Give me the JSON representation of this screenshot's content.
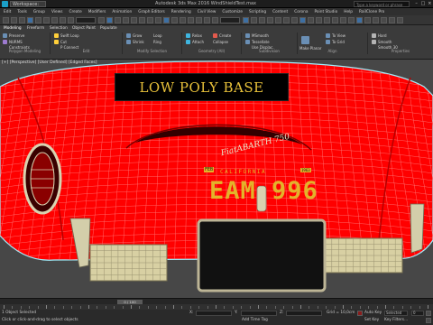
{
  "window": {
    "title": "Autodesk 3ds Max 2016    WindShieldTest.max",
    "workspace": "Workspace: Default",
    "search_placeholder": "Type a keyword or phrase"
  },
  "menu": [
    "Edit",
    "Tools",
    "Group",
    "Views",
    "Create",
    "Modifiers",
    "Animation",
    "Graph Editors",
    "Rendering",
    "Civil View",
    "Customize",
    "Scripting",
    "Content",
    "Corona",
    "Point Studio",
    "Help",
    "RailClone Pro"
  ],
  "ribbon": {
    "tabs": [
      "Modeling",
      "Freeform",
      "Selection",
      "Object Paint",
      "Populate"
    ],
    "groups": [
      {
        "label": "Polygon Modeling",
        "items": [
          "Preserve",
          "NURMS",
          "Constraints"
        ]
      },
      {
        "label": "Edit",
        "items": [
          "Swift Loop",
          "Cut",
          "P Connect"
        ]
      },
      {
        "label": "Modify Selection",
        "items": [
          "Grow",
          "Shrink",
          "Loop",
          "Ring"
        ]
      },
      {
        "label": "Geometry (All)",
        "items": [
          "Relax",
          "Attach",
          "Create",
          "Collapse"
        ]
      },
      {
        "label": "Subdivision",
        "items": [
          "MSmooth",
          "Tessellate",
          "Use Displac."
        ]
      },
      {
        "label": "Align",
        "items": [
          "Make Planar",
          "To View",
          "To Grid"
        ]
      },
      {
        "label": "Properties",
        "items": [
          "Hard",
          "Smooth",
          "Smooth 30"
        ]
      }
    ]
  },
  "viewport": {
    "label": "[+] [Perspective] [User Defined] [Edged Faces]",
    "overlay_text": "LOW POLY BASE",
    "badge_text": "FiatABARTH 750",
    "plate": {
      "state": "CALIFORNIA",
      "month": "FEB",
      "year": "1963",
      "number": "EAM 996"
    },
    "colors": {
      "paint": "#ff0000",
      "wire": "#ff6a6a",
      "chrome": "#c7c2a8",
      "plate": "#111111",
      "plate_text": "#e3b32a"
    }
  },
  "timeline": {
    "frame": "0 / 100",
    "ticks": [
      "0",
      "10",
      "20",
      "30",
      "40",
      "50",
      "60",
      "70",
      "80",
      "90",
      "100"
    ]
  },
  "status": {
    "selection": "1 Object Selected",
    "prompt": "Click or click-and-drag to select objects",
    "x_label": "X:",
    "y_label": "Y:",
    "z_label": "Z:",
    "grid": "Grid = 10,0cm",
    "autokey": "Auto Key",
    "selected_label": "Selected",
    "setkey": "Set Key",
    "keyfilters": "Key Filters...",
    "add_time_tag": "Add Time Tag",
    "frame_value": "0"
  }
}
